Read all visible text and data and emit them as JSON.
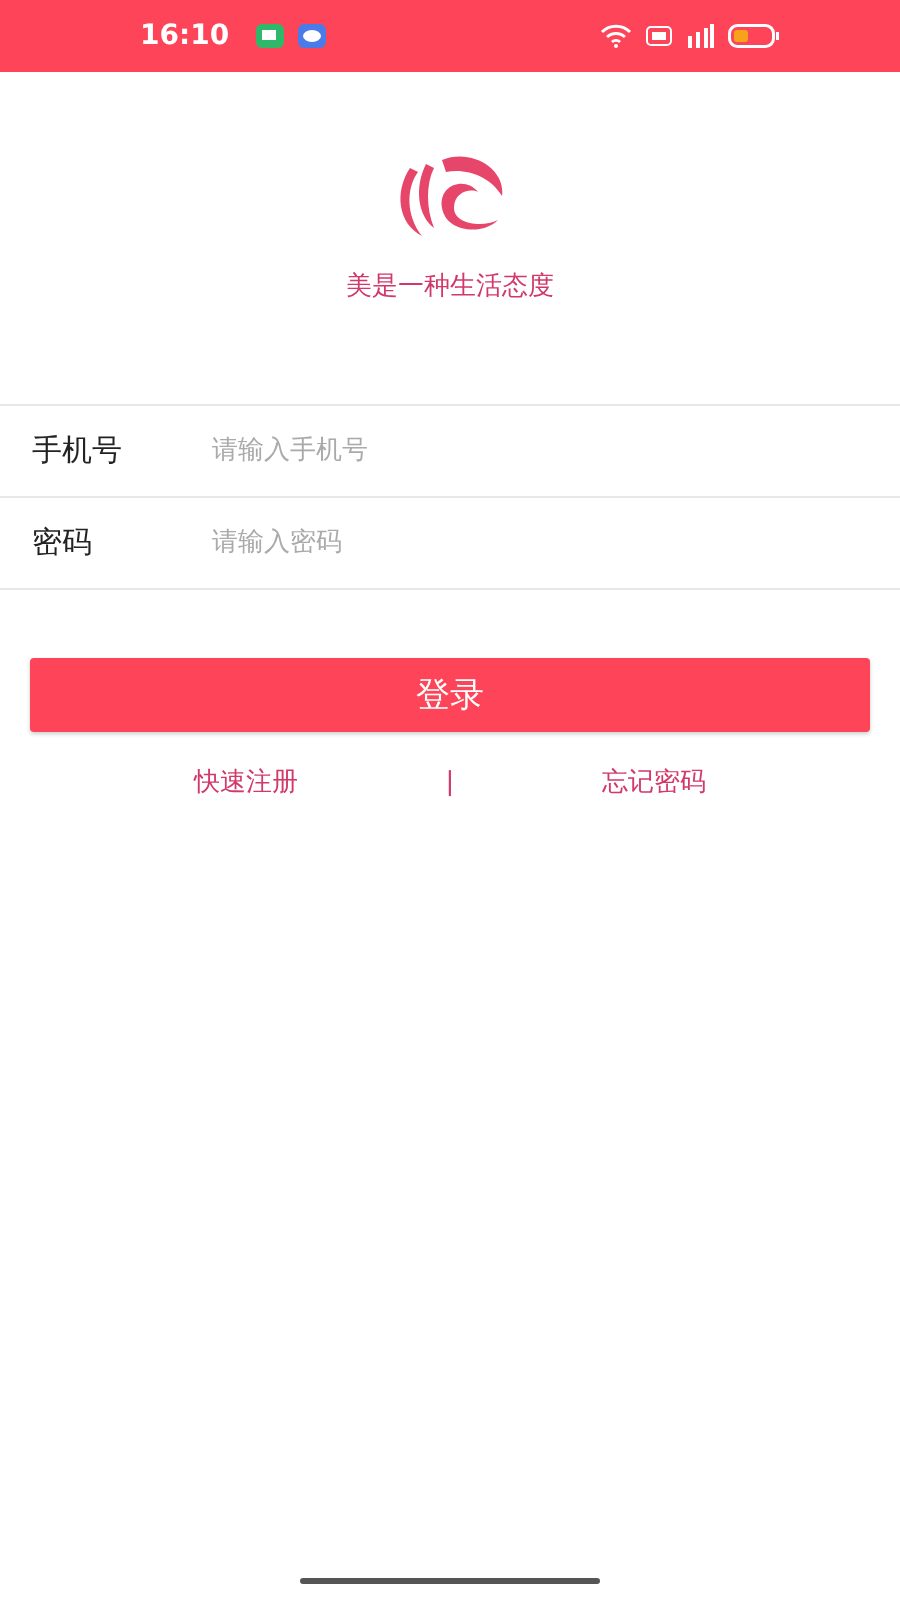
{
  "status_bar": {
    "time": "16:10"
  },
  "slogan": "美是一种生活态度",
  "fields": [
    {
      "label": "手机号",
      "placeholder": "请输入手机号"
    },
    {
      "label": "密码",
      "placeholder": "请输入密码"
    }
  ],
  "login_button": "登录",
  "links": {
    "register": "快速注册",
    "separator": "|",
    "forgot": "忘记密码"
  }
}
